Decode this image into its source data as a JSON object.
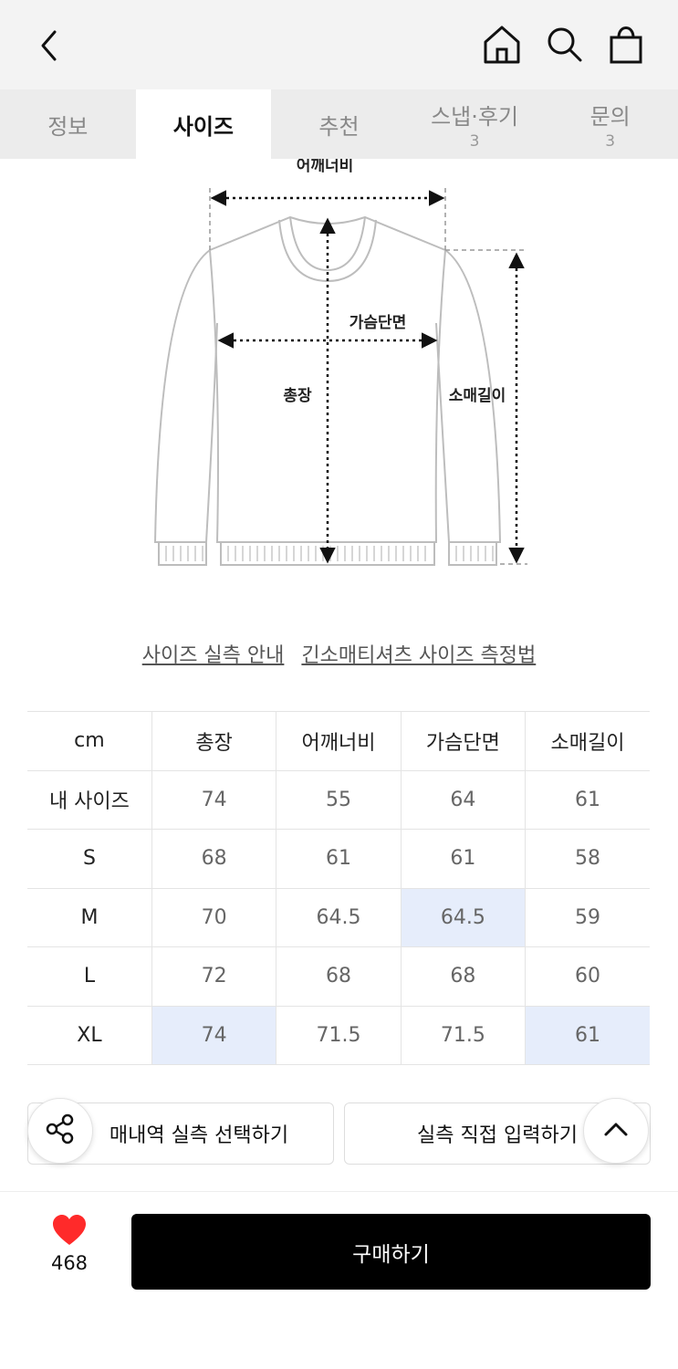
{
  "header": {
    "back_icon": "chevron-left-icon",
    "home_icon": "home-icon",
    "search_icon": "search-icon",
    "cart_icon": "shopping-bag-icon"
  },
  "tabs": [
    {
      "label": "정보",
      "count": ""
    },
    {
      "label": "사이즈",
      "count": "",
      "active": true
    },
    {
      "label": "추천",
      "count": ""
    },
    {
      "label": "스냅·후기",
      "count": "3"
    },
    {
      "label": "문의",
      "count": "3"
    }
  ],
  "diagram": {
    "shoulder_label": "어깨너비",
    "chest_label": "가슴단면",
    "length_label": "총장",
    "sleeve_label": "소매길이"
  },
  "links": {
    "size_guide": "사이즈 실측 안내",
    "measure_method": "긴소매티셔츠 사이즈 측정법"
  },
  "size_table": {
    "headers": [
      "cm",
      "총장",
      "어깨너비",
      "가슴단면",
      "소매길이"
    ],
    "rows": [
      {
        "size": "내 사이즈",
        "values": [
          "74",
          "55",
          "64",
          "61"
        ]
      },
      {
        "size": "S",
        "values": [
          "68",
          "61",
          "61",
          "58"
        ]
      },
      {
        "size": "M",
        "values": [
          "70",
          "64.5",
          "64.5",
          "59"
        ]
      },
      {
        "size": "L",
        "values": [
          "72",
          "68",
          "68",
          "60"
        ]
      },
      {
        "size": "XL",
        "values": [
          "74",
          "71.5",
          "71.5",
          "61"
        ]
      }
    ],
    "highlight_color": "#e6edfb"
  },
  "actions": {
    "purchase_history_label": "매내역 실측 선택하기",
    "direct_input_label": "실측 직접 입력하기",
    "share_icon": "share-icon",
    "scroll_top_icon": "chevron-up-icon"
  },
  "footer": {
    "like_icon": "heart-icon",
    "like_count": "468",
    "like_color": "#ff2a2a",
    "buy_label": "구매하기"
  }
}
